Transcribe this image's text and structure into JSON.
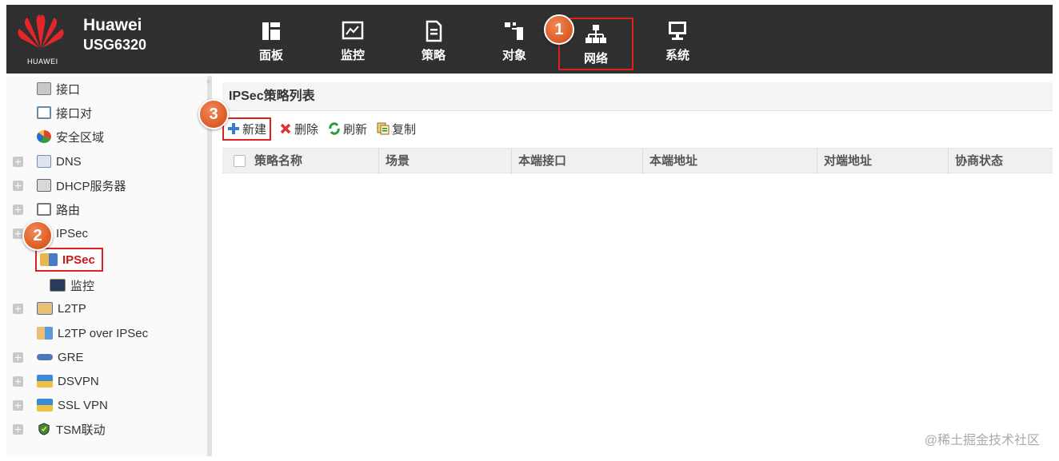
{
  "brand": {
    "logo_text": "HUAWEI",
    "product_name": "Huawei",
    "product_model": "USG6320"
  },
  "nav": [
    {
      "label": "面板",
      "icon": "dashboard-icon"
    },
    {
      "label": "监控",
      "icon": "monitor-chart-icon"
    },
    {
      "label": "策略",
      "icon": "policy-document-icon"
    },
    {
      "label": "对象",
      "icon": "object-icon"
    },
    {
      "label": "网络",
      "icon": "network-icon",
      "active": true
    },
    {
      "label": "系统",
      "icon": "system-monitor-icon"
    }
  ],
  "badges": {
    "step1": "1",
    "step2": "2",
    "step3": "3"
  },
  "sidebar": {
    "items": [
      {
        "label": "接口",
        "icon": "interface-icon"
      },
      {
        "label": "接口对",
        "icon": "interface-pair-icon"
      },
      {
        "label": "安全区域",
        "icon": "security-zone-icon"
      },
      {
        "label": "DNS",
        "icon": "dns-icon"
      },
      {
        "label": "DHCP服务器",
        "icon": "dhcp-server-icon"
      },
      {
        "label": "路由",
        "icon": "route-icon"
      },
      {
        "label": "IPSec",
        "icon": "ipsec-folder-icon"
      },
      {
        "label": "IPSec",
        "icon": "ipsec-icon",
        "selected": true
      },
      {
        "label": "监控",
        "icon": "ipsec-monitor-icon"
      },
      {
        "label": "L2TP",
        "icon": "l2tp-icon"
      },
      {
        "label": "L2TP over IPSec",
        "icon": "l2tp-over-ipsec-icon"
      },
      {
        "label": "GRE",
        "icon": "gre-icon"
      },
      {
        "label": "DSVPN",
        "icon": "dsvpn-icon"
      },
      {
        "label": "SSL VPN",
        "icon": "ssl-vpn-icon"
      },
      {
        "label": "TSM联动",
        "icon": "tsm-shield-icon"
      }
    ]
  },
  "main": {
    "title": "IPSec策略列表",
    "toolbar": {
      "new": "新建",
      "delete": "删除",
      "refresh": "刷新",
      "copy": "复制"
    },
    "columns": [
      "策略名称",
      "场景",
      "本端接口",
      "本端地址",
      "对端地址",
      "协商状态"
    ]
  },
  "watermark": "@稀土掘金技术社区",
  "colors": {
    "header_bg": "#303030",
    "highlight_red": "#e02020",
    "badge_orange": "#e0602a"
  }
}
